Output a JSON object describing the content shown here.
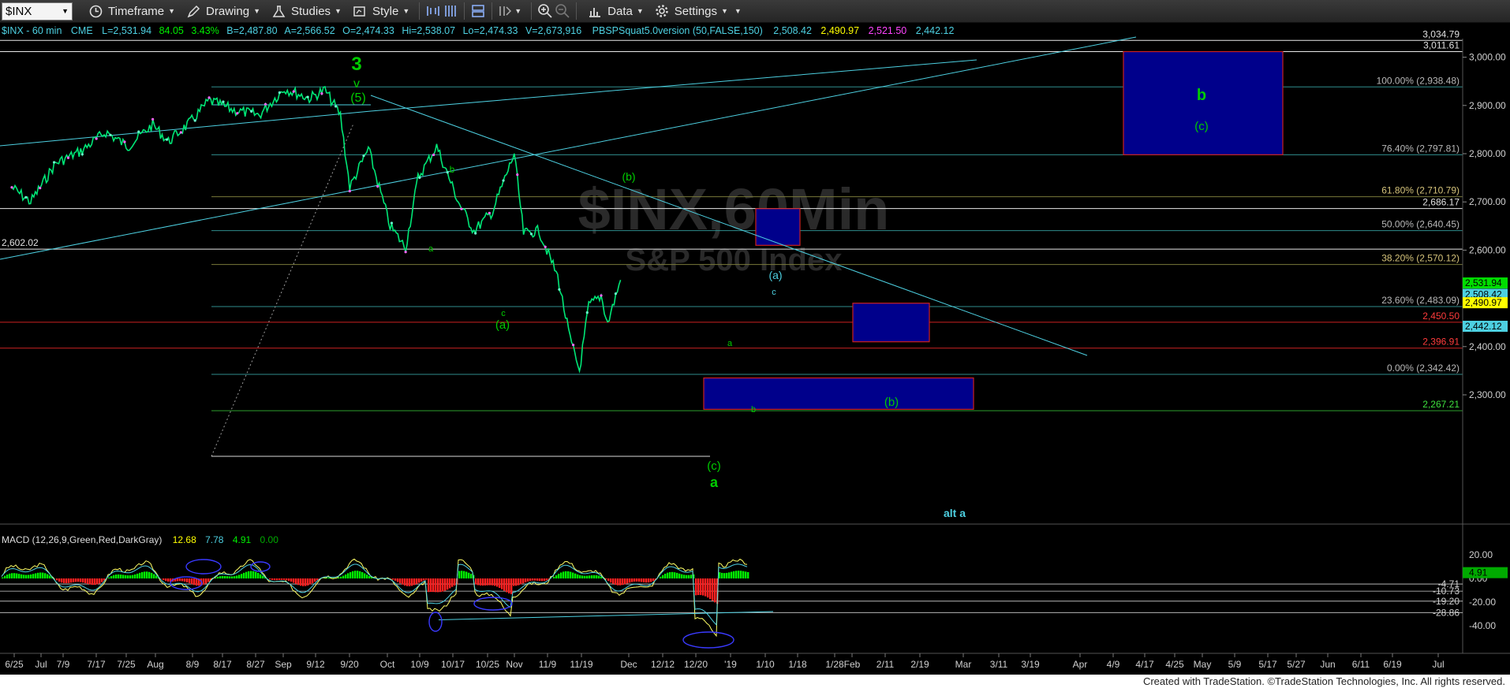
{
  "toolbar": {
    "symbol": "$INX",
    "items": [
      "Timeframe",
      "Drawing",
      "Studies",
      "Style",
      "Data",
      "Settings"
    ]
  },
  "header": {
    "line_label": "$INX - 60 min",
    "exchange": "CME",
    "quote_parts": [
      "L=2,531.94",
      "84.05",
      "3.43%",
      "B=2,487.80",
      "A=2,566.52",
      "O=2,474.33",
      "Hi=2,538.07",
      "Lo=2,474.33",
      "V=2,673,916"
    ],
    "indicator_label": "PBSPSquat5.0version (50,FALSE,150)",
    "indicator_values": [
      "2,508.42",
      "2,490.97",
      "2,521.50",
      "2,442.12"
    ]
  },
  "colors": {
    "price": "#00e676",
    "swing": "#00cc00",
    "accent_cyan": "#4dd0e1",
    "red_level": "#ff3b3b",
    "fib_text": "#b8b8b8",
    "box_fill": "#00008b",
    "box_border": "#cc2020",
    "macd_green": "#00ee00",
    "macd_red": "#ff2020"
  },
  "watermark": {
    "title": "$INX,60Min",
    "subtitle": "S&P 500 Index"
  },
  "chart_data": {
    "type": "line",
    "series_name": "$INX 60 min",
    "ylim": [
      2230,
      3050
    ],
    "y_ticks": [
      2300,
      2400,
      2500,
      2600,
      2700,
      2800,
      2900,
      3000
    ],
    "y_tick_labels": [
      "2,300.00",
      "2,400.00",
      "2,500.00",
      "2,600.00",
      "2,700.00",
      "2,800.00",
      "2,900.00",
      "3,000.00"
    ],
    "x_labels": [
      "6/25",
      "Jul",
      "7/9",
      "7/17",
      "7/25",
      "Aug",
      "8/9",
      "8/17",
      "8/27",
      "Sep",
      "9/12",
      "9/20",
      "Oct",
      "10/9",
      "10/17",
      "10/25",
      "Nov",
      "11/9",
      "11/19",
      "Dec",
      "12/12",
      "12/20",
      "'19",
      "1/10",
      "1/18",
      "1/28",
      "Feb",
      "2/11",
      "2/19",
      "Mar",
      "3/11",
      "3/19",
      "Apr",
      "4/9",
      "4/17",
      "4/25",
      "May",
      "5/9",
      "5/17",
      "5/27",
      "Jun",
      "6/11",
      "6/19",
      "Jul"
    ],
    "price_path": [
      {
        "date": "6/25",
        "v": 2730
      },
      {
        "date": "7/1",
        "v": 2700
      },
      {
        "date": "7/9",
        "v": 2780
      },
      {
        "date": "7/17",
        "v": 2805
      },
      {
        "date": "7/25",
        "v": 2845
      },
      {
        "date": "8/1",
        "v": 2815
      },
      {
        "date": "8/9",
        "v": 2860
      },
      {
        "date": "8/14",
        "v": 2825
      },
      {
        "date": "8/21",
        "v": 2865
      },
      {
        "date": "8/27",
        "v": 2910
      },
      {
        "date": "9/4",
        "v": 2890
      },
      {
        "date": "9/12",
        "v": 2880
      },
      {
        "date": "9/20",
        "v": 2935
      },
      {
        "date": "9/28",
        "v": 2915
      },
      {
        "date": "10/3",
        "v": 2932
      },
      {
        "date": "10/8",
        "v": 2880
      },
      {
        "date": "10/11",
        "v": 2730
      },
      {
        "date": "10/17",
        "v": 2810
      },
      {
        "date": "10/24",
        "v": 2650
      },
      {
        "date": "10/29",
        "v": 2605
      },
      {
        "date": "11/2",
        "v": 2750
      },
      {
        "date": "11/8",
        "v": 2815
      },
      {
        "date": "11/15",
        "v": 2700
      },
      {
        "date": "11/20",
        "v": 2640
      },
      {
        "date": "11/26",
        "v": 2680
      },
      {
        "date": "12/3",
        "v": 2800
      },
      {
        "date": "12/6",
        "v": 2635
      },
      {
        "date": "12/11",
        "v": 2640
      },
      {
        "date": "12/17",
        "v": 2545
      },
      {
        "date": "12/21",
        "v": 2415
      },
      {
        "date": "12/24",
        "v": 2350
      },
      {
        "date": "12/27",
        "v": 2485
      },
      {
        "date": "12/31",
        "v": 2505
      },
      {
        "date": "1/3",
        "v": 2448
      },
      {
        "date": "1/7",
        "v": 2538
      }
    ],
    "levels": [
      {
        "label": "3,034.79",
        "value": 3034.79,
        "style": "white"
      },
      {
        "label": "3,011.61",
        "value": 3011.61,
        "style": "white"
      },
      {
        "label": "100.00% (2,938.48)",
        "value": 2938.48,
        "style": "fib"
      },
      {
        "label": "76.40% (2,797.81)",
        "value": 2797.81,
        "style": "fib"
      },
      {
        "label": "61.80% (2,710.79)",
        "value": 2710.79,
        "style": "fibgold"
      },
      {
        "label": "2,686.17",
        "value": 2686.17,
        "style": "white"
      },
      {
        "label": "50.00% (2,640.45)",
        "value": 2640.45,
        "style": "fib"
      },
      {
        "label": "2,602.02",
        "value": 2602.02,
        "style": "white"
      },
      {
        "label": "38.20% (2,570.12)",
        "value": 2570.12,
        "style": "fibgold"
      },
      {
        "label": "23.60% (2,483.09)",
        "value": 2483.09,
        "style": "fib"
      },
      {
        "label": "2,450.50",
        "value": 2450.5,
        "style": "red"
      },
      {
        "label": "2,396.91",
        "value": 2396.91,
        "style": "red"
      },
      {
        "label": "0.00% (2,342.42)",
        "value": 2342.42,
        "style": "fib"
      },
      {
        "label": "2,267.21",
        "value": 2267.21,
        "style": "green"
      }
    ],
    "price_badges": [
      {
        "label": "2,531.94",
        "value": 2531.94,
        "color": "#00dd00"
      },
      {
        "label": "2,508.42",
        "value": 2508.42,
        "color": "#4dd0e1"
      },
      {
        "label": "2,490.97",
        "value": 2490.97,
        "color": "#ffff00"
      },
      {
        "label": "2,442.12",
        "value": 2442.12,
        "color": "#4dd0e1"
      }
    ],
    "wave_labels": [
      "3",
      "v",
      "(5)",
      "(b)",
      "b",
      "a",
      "c",
      "(a)",
      "a",
      "b",
      "(c)",
      "a",
      "(a)",
      "c",
      "(b)",
      "b",
      "(c)",
      "alt a"
    ],
    "target_boxes": [
      {
        "label": "(a) c",
        "y_top": 2686,
        "y_bottom": 2610
      },
      {
        "label": "(b)",
        "y_top": 2490,
        "y_bottom": 2410
      },
      {
        "label": "b (c)",
        "y_top": 3011.61,
        "y_bottom": 2797.81
      },
      {
        "label": "(c) a",
        "y_top": 2335,
        "y_bottom": 2270
      }
    ],
    "macd": {
      "label": "MACD (12,26,9,Green,Red,DarkGray)",
      "values": [
        "12.68",
        "7.78",
        "4.91",
        "0.00"
      ],
      "ylim": [
        -45,
        27
      ],
      "y_tick_labels": [
        "20.00",
        "0.00",
        "-20.00",
        "-40.00"
      ],
      "levels": [
        "-4.71",
        "-10.73",
        "-19.20",
        "-28.86"
      ],
      "badge": "4.91"
    }
  },
  "footer": {
    "credit": "Created with TradeStation. ©TradeStation Technologies, Inc. All rights reserved."
  }
}
